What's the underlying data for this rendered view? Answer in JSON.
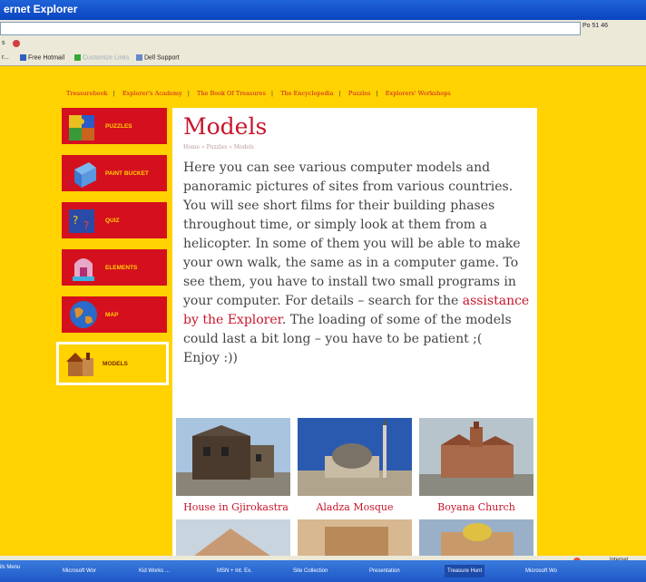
{
  "window": {
    "title": "ernet Explorer"
  },
  "toolbar": {
    "right_text": "Po 51 46",
    "menu_partial_1": "s",
    "menu_partial_2": "r...",
    "links": [
      "Free Hotmail",
      "Customize Links",
      "Dell Support"
    ]
  },
  "top_nav": [
    "Treasurebook",
    "Explorer's Academy",
    "The Book Of Treasures",
    "The Encyclopedia",
    "Puzzles",
    "Explorers' Workshops"
  ],
  "sidebar": [
    {
      "label": "PUZZLES",
      "icon": "puzzle-icon"
    },
    {
      "label": "PAINT BUCKET",
      "icon": "paint-bucket-icon"
    },
    {
      "label": "QUIZ",
      "icon": "quiz-icon"
    },
    {
      "label": "ELEMENTS",
      "icon": "elements-icon"
    },
    {
      "label": "MAP",
      "icon": "globe-icon"
    },
    {
      "label": "MODELS",
      "icon": "models-icon"
    }
  ],
  "main": {
    "title": "Models",
    "breadcrumb": "Home » Puzzles » Models",
    "paragraph_start": "Here you can see various computer models and panoramic pictures of sites from various countries. You will see short films for their building phases throughout time, or simply look at them from a helicopter. In some of them you will be able to make your own walk, the same as in a computer game. To see them, you have to install two small programs in your computer. For details – search for the ",
    "paragraph_link": "assistance by the Explorer",
    "paragraph_end": ". The loading of some of the models could last a bit long – you have to be patient ;(",
    "enjoy": "Enjoy :))"
  },
  "gallery": [
    {
      "caption": "House in Gjirokastra"
    },
    {
      "caption": "Aladza Mosque"
    },
    {
      "caption": "Boyana Church"
    }
  ],
  "status": {
    "zone": "Internet"
  },
  "taskbar": {
    "start_hint": "ils Menu",
    "tasks": [
      "Microsoft Wor",
      "Kid Works ...",
      "MSN + Int. Ex.",
      "Site Collection",
      "Presentation",
      "Treasure Hunt",
      "Microsoft Wo"
    ]
  },
  "colors": {
    "accent_red": "#c8152a",
    "page_yellow": "#ffd200"
  }
}
